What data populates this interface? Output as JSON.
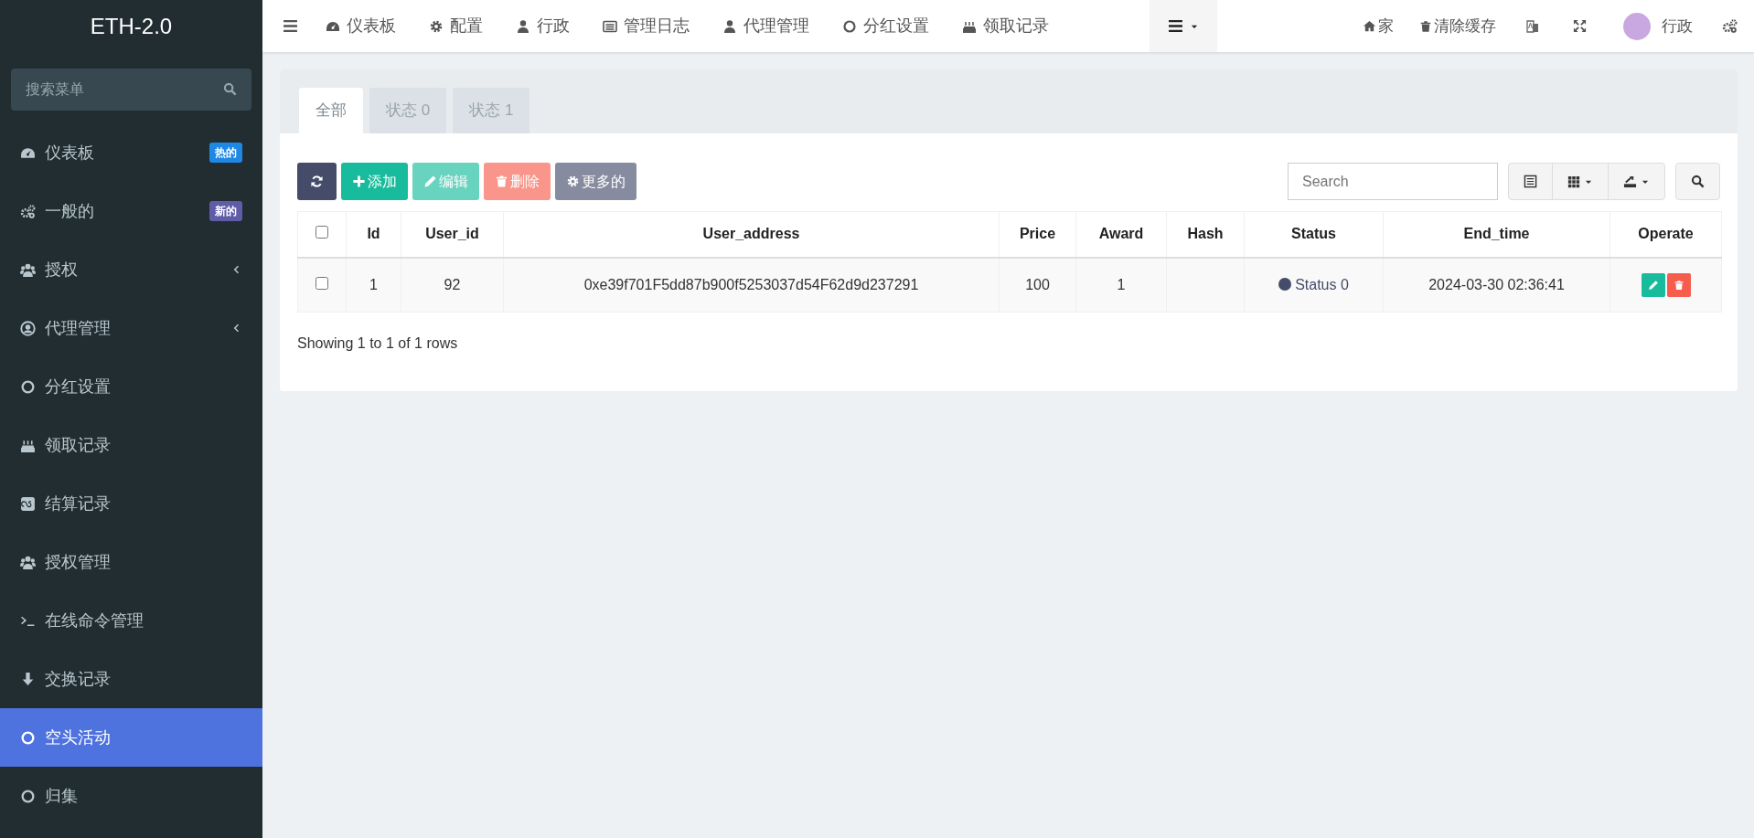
{
  "sidebar": {
    "brand": "ETH-2.0",
    "search": {
      "placeholder": "搜索菜单"
    },
    "items": [
      {
        "label": "仪表板",
        "badge": {
          "text": "热的",
          "color": "#1e88e5"
        },
        "has_submenu": false,
        "selected": false
      },
      {
        "label": "一般的",
        "badge": {
          "text": "新的",
          "color": "#605ca8"
        },
        "has_submenu": false,
        "selected": false
      },
      {
        "label": "授权",
        "has_submenu": true,
        "selected": false
      },
      {
        "label": "代理管理",
        "has_submenu": true,
        "selected": false
      },
      {
        "label": "分红设置",
        "has_submenu": false,
        "selected": false
      },
      {
        "label": "领取记录",
        "has_submenu": false,
        "selected": false
      },
      {
        "label": "结算记录",
        "has_submenu": false,
        "selected": false
      },
      {
        "label": "授权管理",
        "has_submenu": false,
        "selected": false
      },
      {
        "label": "在线命令管理",
        "has_submenu": false,
        "selected": false
      },
      {
        "label": "交换记录",
        "has_submenu": false,
        "selected": false
      },
      {
        "label": "空头活动",
        "has_submenu": false,
        "selected": true
      },
      {
        "label": "归集",
        "has_submenu": false,
        "selected": false
      }
    ]
  },
  "top_nav": {
    "items": [
      "仪表板",
      "配置",
      "行政",
      "管理日志",
      "代理管理",
      "分红设置",
      "领取记录"
    ],
    "right": {
      "home": "家",
      "clear_cache": "清除缓存",
      "user": "行政"
    }
  },
  "panel": {
    "tabs": [
      {
        "label": "全部",
        "selected": true
      },
      {
        "label": "状态 0",
        "selected": false
      },
      {
        "label": "状态 1",
        "selected": false
      }
    ],
    "toolbar": [
      {
        "kind": "refresh",
        "disabled": false
      },
      {
        "kind": "add",
        "label": "添加",
        "disabled": false
      },
      {
        "kind": "edit",
        "label": "编辑",
        "disabled": true
      },
      {
        "kind": "delete",
        "label": "删除",
        "disabled": true
      },
      {
        "kind": "more",
        "label": "更多的",
        "disabled": false
      }
    ],
    "search": {
      "placeholder": "Search"
    },
    "table": {
      "select_all_checked": false,
      "columns": [
        "Id",
        "User_id",
        "User_address",
        "Price",
        "Award",
        "Hash",
        "Status",
        "End_time",
        "Operate"
      ],
      "rows": [
        {
          "checked": false,
          "id": "1",
          "user_id": "92",
          "user_address": "0xe39f701F5dd87b900f5253037d54F62d9d237291",
          "price": "100",
          "award": "1",
          "status": {
            "text": "Status 0",
            "color": "#444c69"
          },
          "end_time": "2024-03-30 02:36:41"
        }
      ]
    },
    "footer": "Showing 1 to 1 of 1 rows"
  }
}
